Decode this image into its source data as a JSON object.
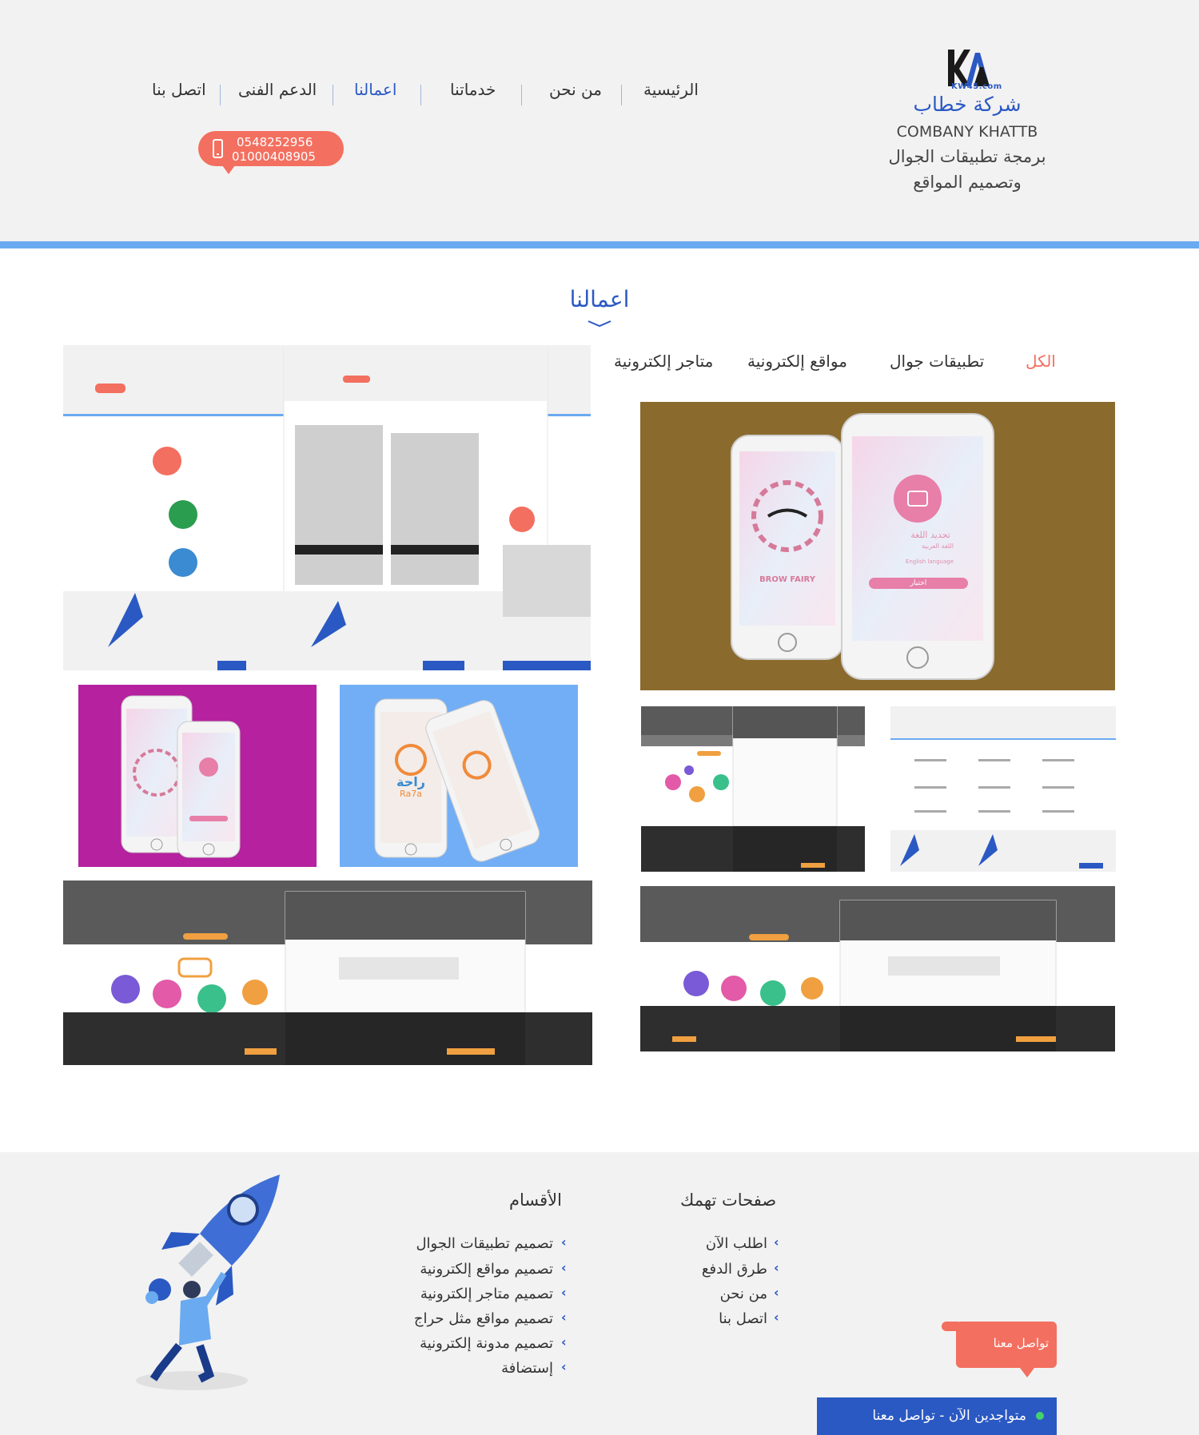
{
  "header": {
    "logo_text": "KW45.com",
    "company_name_ar": "شركة خطاب",
    "company_name_en": "COMBANY KHATTB",
    "tagline_line1": "برمجة تطبيقات الجوال",
    "tagline_line2": "وتصميم المواقع",
    "nav": [
      {
        "label": "الرئيسية",
        "active": false
      },
      {
        "label": "من نحن",
        "active": false
      },
      {
        "label": "خدماتنا",
        "active": false
      },
      {
        "label": "اعمالنا",
        "active": true
      },
      {
        "label": "الدعم الفنى",
        "active": false
      },
      {
        "label": "اتصل بنا",
        "active": false
      }
    ],
    "phones": [
      "0548252956",
      "01000408905"
    ]
  },
  "works": {
    "title": "اعمالنا",
    "filters": [
      {
        "label": "الكل",
        "active": true
      },
      {
        "label": "تطبيقات جوال",
        "active": false
      },
      {
        "label": "مواقع إلكترونية",
        "active": false
      },
      {
        "label": "متاجر إلكترونية",
        "active": false
      }
    ],
    "app_labels": {
      "brow_fairy": "BROW FAIRY",
      "choose_language": "تحديد اللغة",
      "arabic_language": "اللغة العربية",
      "english_language": "English language",
      "choose_button": "اختيار",
      "raha_ar": "راحة",
      "raha_en": "Ra7a"
    }
  },
  "footer": {
    "pages_title": "صفحات تهمك",
    "pages": [
      "اطلب الآن",
      "طرق الدفع",
      "من نحن",
      "اتصل بنا"
    ],
    "sections_title": "الأقسام",
    "sections": [
      "تصميم تطبيقات الجوال",
      "تصميم مواقع إلكترونية",
      "تصميم متاجر إلكترونية",
      "تصميم مواقع مثل حراج",
      "تصميم مدونة إلكترونية",
      "إستضافة"
    ],
    "contact_label": "تواصل معنا",
    "online_label": "متواجدين الآن - تواصل معنا"
  },
  "colors": {
    "brand_blue": "#2b59c3",
    "accent_coral": "#f36f5f",
    "header_bg": "#f2f2f2",
    "header_bar": "#6aaaf0",
    "tile_brown": "#8b6a2e",
    "tile_magenta": "#b5219e",
    "tile_sky": "#72aef5"
  }
}
